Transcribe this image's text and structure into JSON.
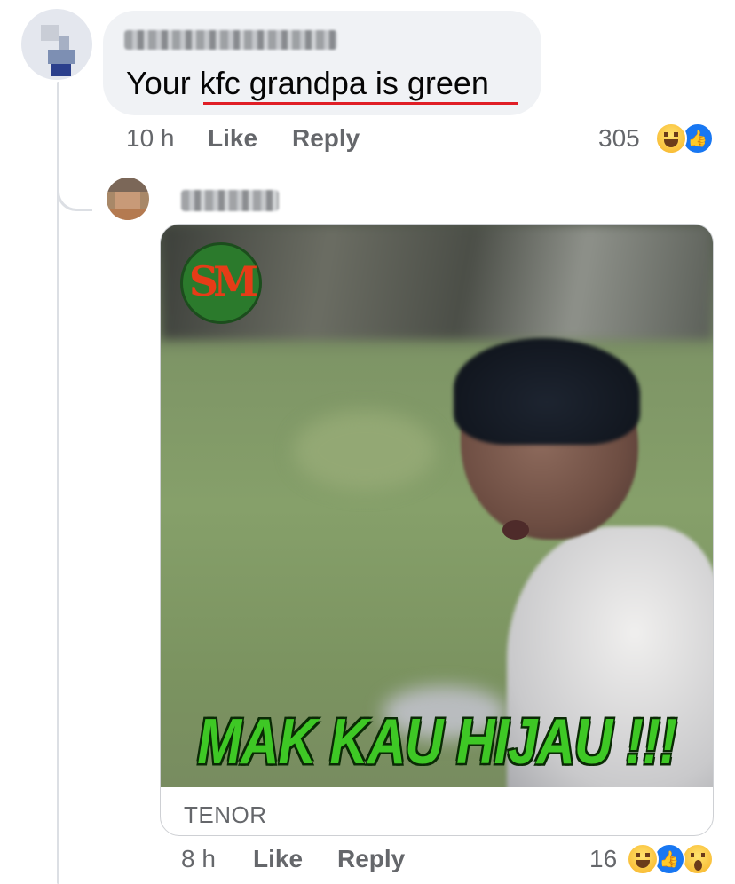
{
  "comment_1": {
    "text": "Your kfc grandpa is green",
    "time": "10 h",
    "like_label": "Like",
    "reply_label": "Reply",
    "reaction_count": "305",
    "reactions": [
      "haha-icon",
      "like-icon"
    ]
  },
  "reply_1": {
    "gif": {
      "logo_text": "SM",
      "caption": "MAK KAU HIJAU !!!",
      "source_label": "TENOR"
    },
    "time": "8 h",
    "like_label": "Like",
    "reply_label": "Reply",
    "reaction_count": "16",
    "reactions": [
      "haha-icon",
      "like-icon",
      "wow-icon"
    ]
  },
  "colors": {
    "link_blue": "#1877f2",
    "bubble_bg": "#f0f2f5",
    "meta_text": "#65676b",
    "underline_red": "#e01e26",
    "caption_green": "#3ec825"
  }
}
